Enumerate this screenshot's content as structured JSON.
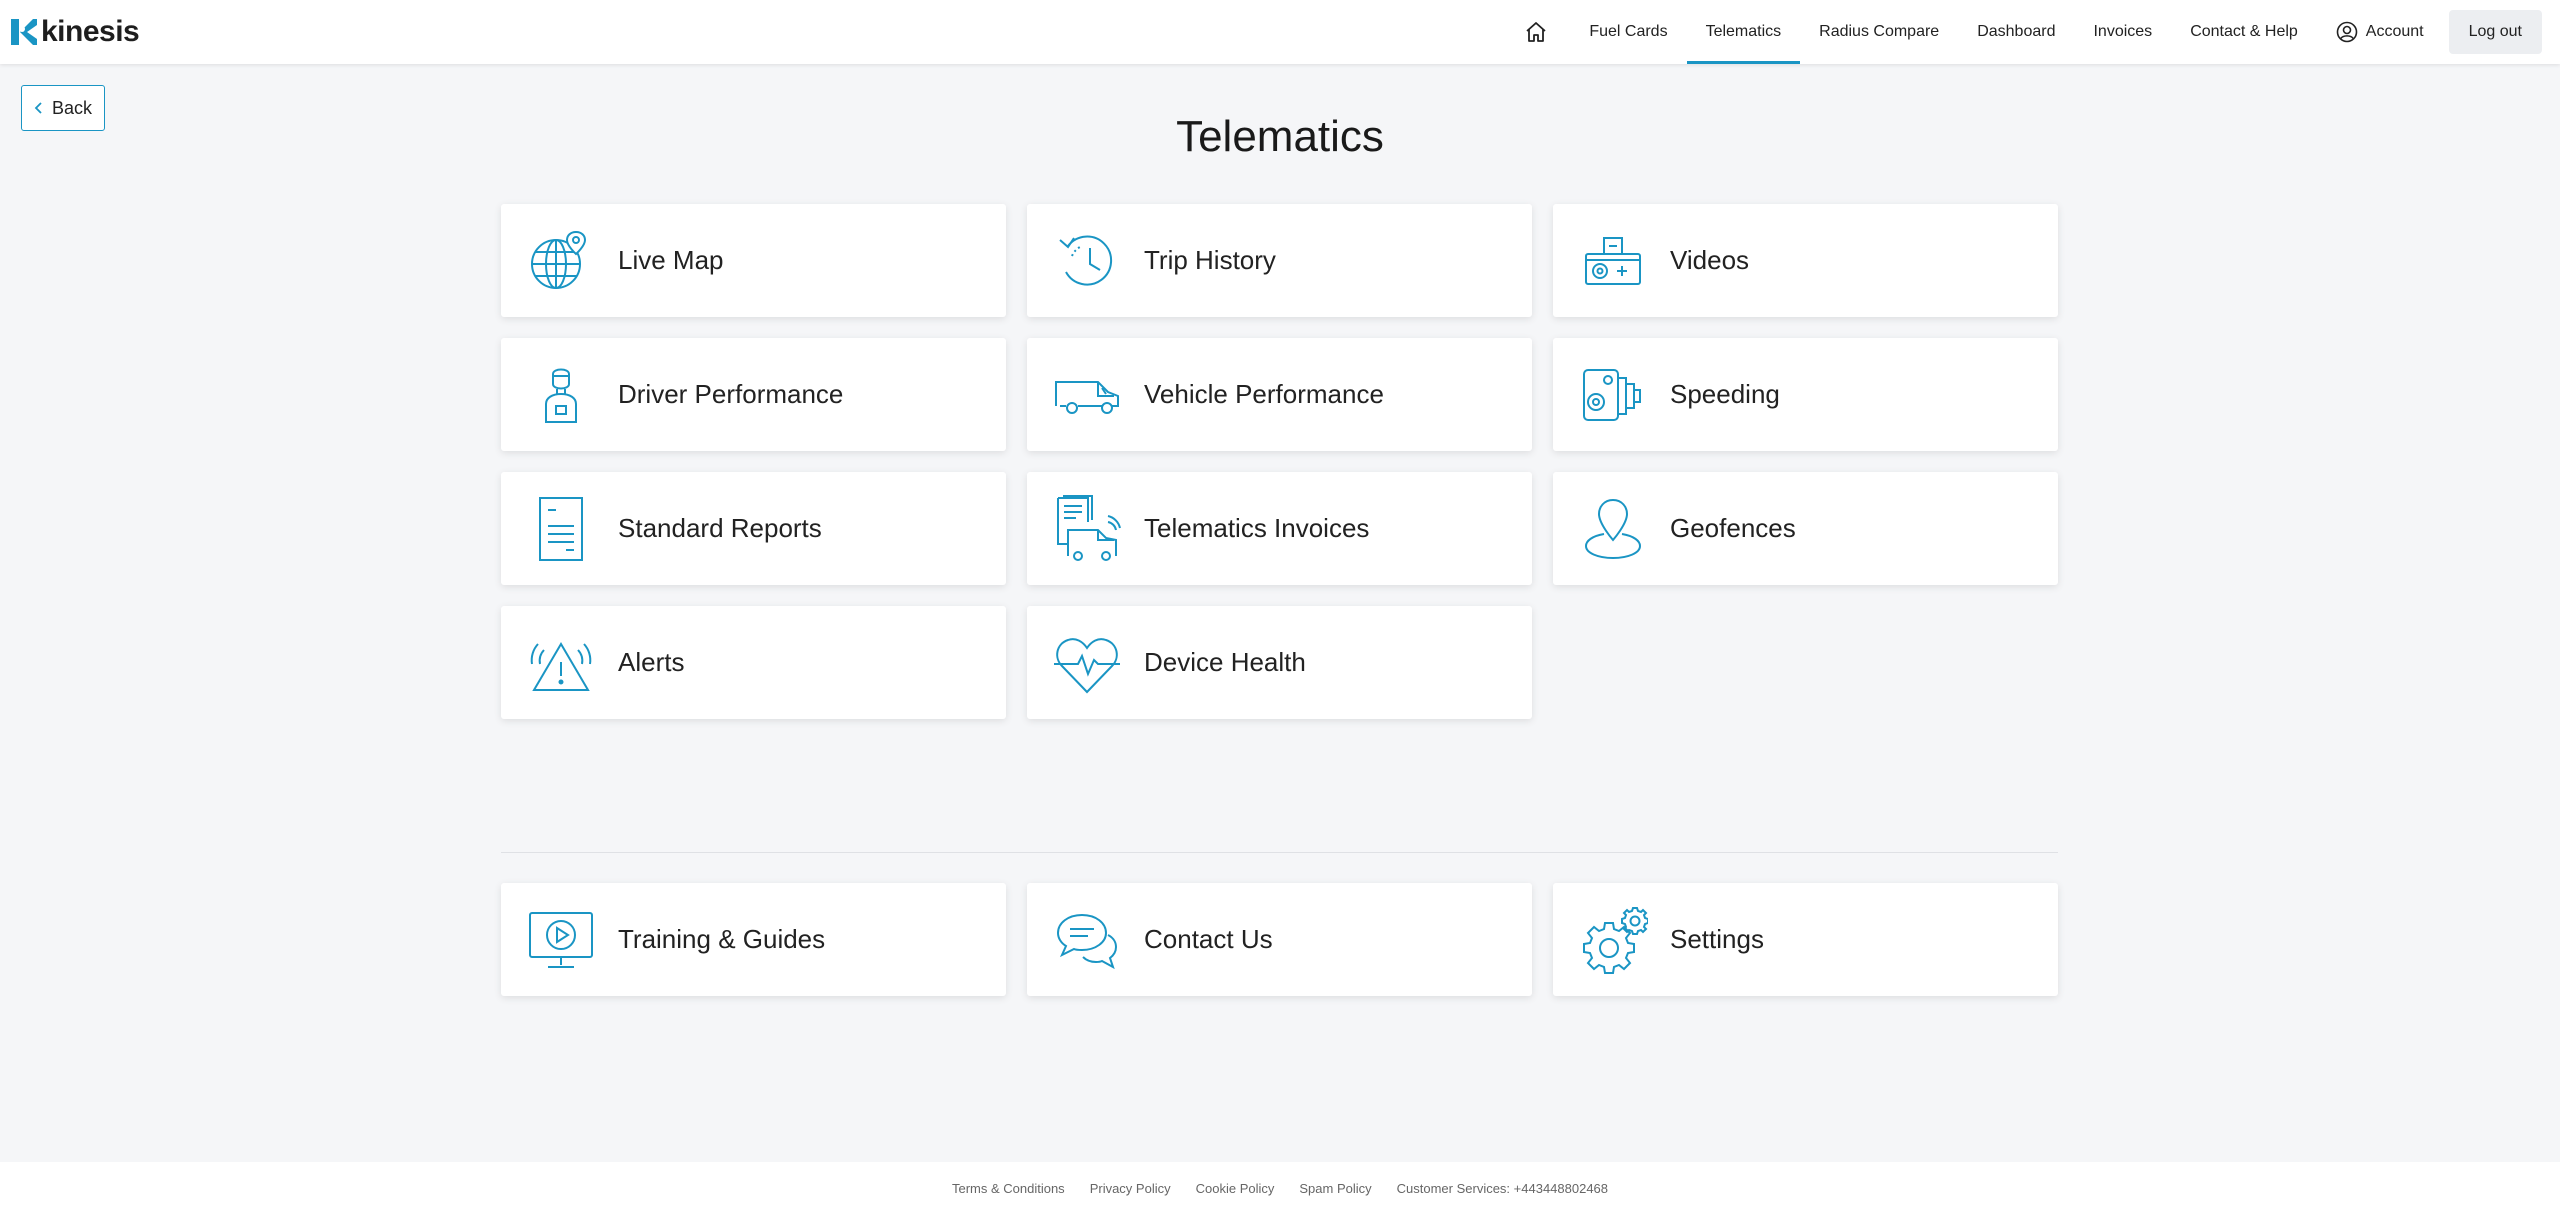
{
  "brand": {
    "name": "kinesis",
    "accent": "#1a95c4"
  },
  "nav": {
    "home_icon": "home-icon",
    "items": [
      {
        "label": "Fuel Cards",
        "active": false
      },
      {
        "label": "Telematics",
        "active": true
      },
      {
        "label": "Radius Compare",
        "active": false
      },
      {
        "label": "Dashboard",
        "active": false
      },
      {
        "label": "Invoices",
        "active": false
      },
      {
        "label": "Contact & Help",
        "active": false
      }
    ],
    "account_label": "Account",
    "logout_label": "Log out"
  },
  "back_label": "Back",
  "page_title": "Telematics",
  "tiles": [
    {
      "label": "Live Map",
      "icon": "globe-pin-icon"
    },
    {
      "label": "Trip History",
      "icon": "history-clock-icon"
    },
    {
      "label": "Videos",
      "icon": "dashcam-icon"
    },
    {
      "label": "Driver Performance",
      "icon": "driver-icon"
    },
    {
      "label": "Vehicle Performance",
      "icon": "van-icon"
    },
    {
      "label": "Speeding",
      "icon": "speed-camera-icon"
    },
    {
      "label": "Standard Reports",
      "icon": "report-document-icon"
    },
    {
      "label": "Telematics Invoices",
      "icon": "invoice-van-icon"
    },
    {
      "label": "Geofences",
      "icon": "map-pin-icon"
    },
    {
      "label": "Alerts",
      "icon": "alert-triangle-icon"
    },
    {
      "label": "Device Health",
      "icon": "heartbeat-icon"
    }
  ],
  "support_tiles": [
    {
      "label": "Training & Guides",
      "icon": "monitor-play-icon"
    },
    {
      "label": "Contact Us",
      "icon": "chat-bubbles-icon"
    },
    {
      "label": "Settings",
      "icon": "gears-icon"
    }
  ],
  "footer": {
    "links": [
      "Terms & Conditions",
      "Privacy Policy",
      "Cookie Policy",
      "Spam Policy"
    ],
    "customer_services": "Customer Services: +443448802468"
  }
}
